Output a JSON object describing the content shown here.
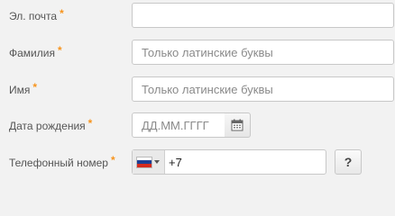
{
  "form": {
    "email": {
      "label": "Эл. почта",
      "required_mark": "*",
      "value": "",
      "placeholder": ""
    },
    "last_name": {
      "label": "Фамилия",
      "required_mark": "*",
      "value": "",
      "placeholder": "Только латинские буквы"
    },
    "first_name": {
      "label": "Имя",
      "required_mark": "*",
      "value": "",
      "placeholder": "Только латинские буквы"
    },
    "birth_date": {
      "label": "Дата рождения",
      "required_mark": "*",
      "value": "",
      "placeholder": "ДД.ММ.ГГГГ",
      "button_icon": "calendar-icon"
    },
    "phone": {
      "label": "Телефонный номер",
      "required_mark": "*",
      "value": "+7",
      "country_icon": "russia-flag-icon",
      "help_label": "?"
    }
  },
  "colors": {
    "required": "#f7941d",
    "border": "#c8c8c8",
    "background": "#f2f2f2"
  }
}
